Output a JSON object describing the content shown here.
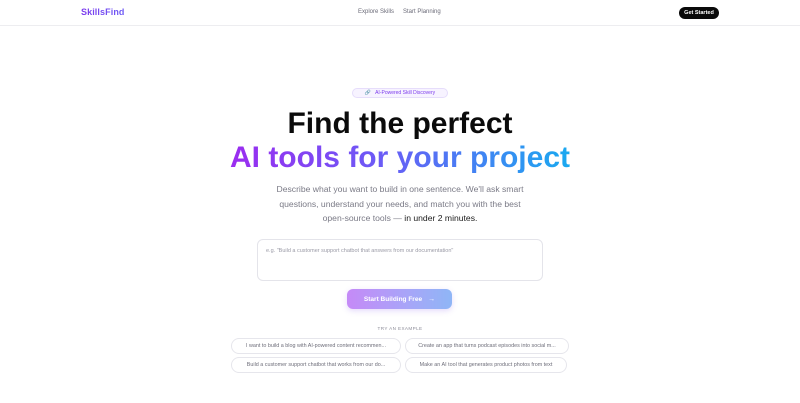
{
  "header": {
    "logo": "SkillsFind",
    "nav": [
      "Explore Skills",
      "Start Planning"
    ],
    "cta_label": "Get Started"
  },
  "hero": {
    "badge_icon": "link-icon",
    "badge_text": "AI-Powered Skill Discovery",
    "title_line1": "Find the perfect",
    "title_line2": "AI tools for your project",
    "subtitle_main": "Describe what you want to build in one sentence. We'll ask smart questions, understand your needs, and match you with the best open-source tools —",
    "subtitle_strong": "in under 2 minutes."
  },
  "prompt": {
    "placeholder": "e.g. \"Build a customer support chatbot that answers from our documentation\"",
    "value": ""
  },
  "start_button": {
    "label": "Start Building Free",
    "icon": "arrow-right-icon"
  },
  "examples": {
    "label": "TRY AN EXAMPLE",
    "items": [
      "I want to build a blog with AI-powered content recommen...",
      "Create an app that turns podcast episodes into social m...",
      "Build a customer support chatbot that works from our do...",
      "Make an AI tool that generates product photos from text"
    ]
  },
  "colors": {
    "brand_purple": "#7c3aed",
    "gradient_start": "#9b2cf0",
    "gradient_end": "#1aa9f0"
  }
}
